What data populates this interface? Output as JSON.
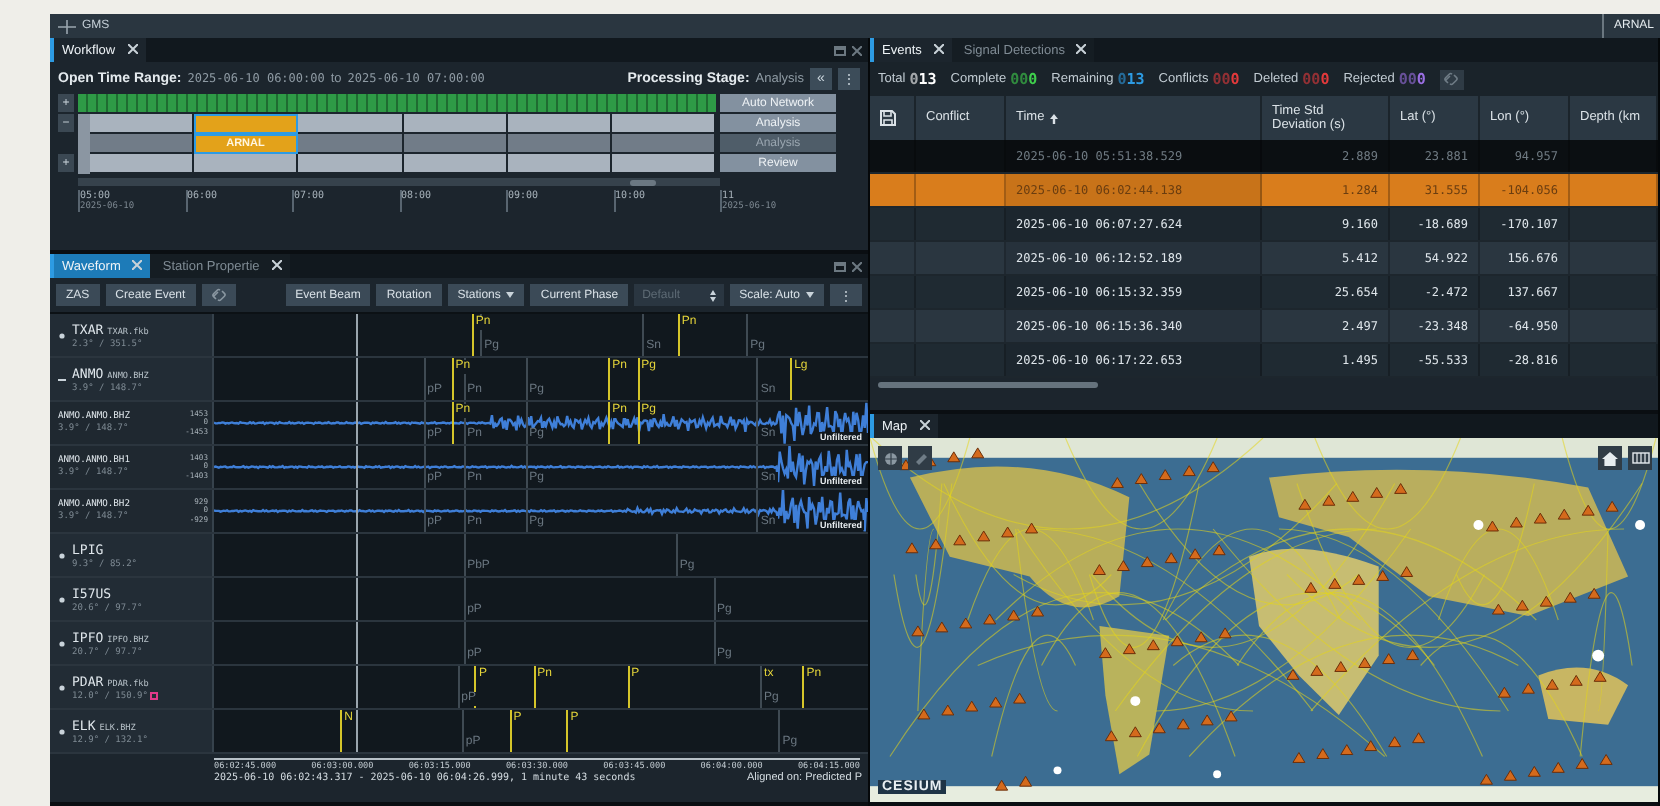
{
  "app": {
    "title": "GMS",
    "user": "ARNAL"
  },
  "workflow": {
    "tab": "Workflow",
    "range_label": "Open Time Range:",
    "range_start": "2025-06-10 06:00:00",
    "range_joiner": "to",
    "range_end": "2025-06-10 07:00:00",
    "stage_label": "Processing Stage:",
    "stage": "Analysis",
    "collapse_button": "«",
    "menu_button": "⋮",
    "rows": [
      {
        "kind": "network",
        "toggle": "+",
        "stage": "Auto Network",
        "disabled": false
      },
      {
        "kind": "interval",
        "toggle": "−",
        "stage": "Analysis",
        "disabled": false,
        "cells": [
          {
            "selected": false
          },
          {
            "selected": true
          },
          {
            "selected": false
          },
          {
            "selected": false
          },
          {
            "selected": false
          },
          {
            "selected": false
          }
        ]
      },
      {
        "kind": "interval",
        "stage": "Analysis",
        "disabled": true,
        "cells": [
          {
            "selected": false
          },
          {
            "selected": true,
            "label": "ARNAL"
          },
          {
            "selected": false
          },
          {
            "selected": false
          },
          {
            "selected": false
          },
          {
            "selected": false
          }
        ]
      },
      {
        "kind": "interval",
        "toggle": "+",
        "stage": "Review",
        "disabled": false,
        "cells": [
          {
            "selected": false
          },
          {
            "selected": false
          },
          {
            "selected": false
          },
          {
            "selected": false
          },
          {
            "selected": false
          },
          {
            "selected": false
          }
        ]
      }
    ],
    "axis": [
      {
        "time": "05:00",
        "date": "2025-06-10"
      },
      {
        "time": "06:00"
      },
      {
        "time": "07:00"
      },
      {
        "time": "08:00"
      },
      {
        "time": "09:00"
      },
      {
        "time": "10:00"
      },
      {
        "time": "11",
        "date": "2025-06-10"
      }
    ]
  },
  "waveform": {
    "tabs": [
      {
        "label": "Waveform",
        "selected": true
      },
      {
        "label": "Station Propertie",
        "selected": false
      }
    ],
    "toolbar": [
      {
        "kind": "button",
        "label": "ZAS"
      },
      {
        "kind": "button",
        "label": "Create Event"
      },
      {
        "kind": "icon"
      },
      {
        "kind": "spacer"
      },
      {
        "kind": "button",
        "label": "Event Beam"
      },
      {
        "kind": "button",
        "label": "Rotation"
      },
      {
        "kind": "menu",
        "label": "Stations"
      },
      {
        "kind": "button",
        "label": "Current Phase"
      },
      {
        "kind": "select",
        "label": "Default",
        "disabled": true
      },
      {
        "kind": "menu",
        "label": "Scale: Auto"
      },
      {
        "kind": "more",
        "label": "⋮"
      }
    ],
    "rows": [
      {
        "kind": "station",
        "name": "TXAR",
        "channel": "TXAR.fkb",
        "location": "2.3° / 351.5°",
        "expanded": false,
        "flagged": false,
        "phases": [
          {
            "label": "Pn",
            "kind": "detection"
          },
          {
            "label": "Pg",
            "kind": "predicted"
          },
          {
            "label": "Sn",
            "kind": "predicted"
          },
          {
            "label": "Pn",
            "kind": "detection"
          },
          {
            "label": "Pg",
            "kind": "predicted"
          }
        ]
      },
      {
        "kind": "station",
        "name": "ANMO",
        "channel": "ANMO.BHZ",
        "location": "3.9° / 148.7°",
        "expanded": true,
        "flagged": false,
        "phases": [
          {
            "label": "pP",
            "kind": "predicted"
          },
          {
            "label": "Pn",
            "kind": "detection"
          },
          {
            "label": "Pn",
            "kind": "predicted"
          },
          {
            "label": "Pg",
            "kind": "predicted"
          },
          {
            "label": "Pn",
            "kind": "detection"
          },
          {
            "label": "Pg",
            "kind": "detection"
          },
          {
            "label": "Sn",
            "kind": "predicted"
          },
          {
            "label": "Lg",
            "kind": "detection"
          }
        ]
      },
      {
        "kind": "channel",
        "name": "ANMO.ANMO.BHZ",
        "location": "3.9° / 148.7°",
        "scale": [
          "1453",
          "0",
          "-1453"
        ],
        "filter": "Unfiltered",
        "phases": [
          {
            "label": "pP",
            "kind": "predicted"
          },
          {
            "label": "Pn",
            "kind": "detection"
          },
          {
            "label": "Pn",
            "kind": "predicted"
          },
          {
            "label": "Pg",
            "kind": "predicted"
          },
          {
            "label": "Pn",
            "kind": "detection"
          },
          {
            "label": "Pg",
            "kind": "detection"
          },
          {
            "label": "Sn",
            "kind": "predicted"
          }
        ]
      },
      {
        "kind": "channel",
        "name": "ANMO.ANMO.BH1",
        "location": "3.9° / 148.7°",
        "scale": [
          "1403",
          "0",
          "-1403"
        ],
        "filter": "Unfiltered",
        "phases": [
          {
            "label": "pP",
            "kind": "predicted"
          },
          {
            "label": "Pn",
            "kind": "predicted"
          },
          {
            "label": "Pg",
            "kind": "predicted"
          },
          {
            "label": "Sn",
            "kind": "predicted"
          }
        ]
      },
      {
        "kind": "channel",
        "name": "ANMO.ANMO.BH2",
        "location": "3.9° / 148.7°",
        "scale": [
          "929",
          "0",
          "-929"
        ],
        "filter": "Unfiltered",
        "phases": [
          {
            "label": "pP",
            "kind": "predicted"
          },
          {
            "label": "Pn",
            "kind": "predicted"
          },
          {
            "label": "Pg",
            "kind": "predicted"
          },
          {
            "label": "Sn",
            "kind": "predicted"
          }
        ]
      },
      {
        "kind": "station",
        "name": "LPIG",
        "location": "9.3° / 85.2°",
        "expanded": false,
        "flagged": false,
        "phases": [
          {
            "label": "PbP",
            "kind": "predicted"
          },
          {
            "label": "Pg",
            "kind": "predicted"
          }
        ]
      },
      {
        "kind": "station",
        "name": "I57US",
        "location": "20.6° / 97.7°",
        "expanded": false,
        "flagged": false,
        "phases": [
          {
            "label": "pP",
            "kind": "predicted"
          },
          {
            "label": "Pg",
            "kind": "predicted"
          }
        ]
      },
      {
        "kind": "station",
        "name": "IPFO",
        "channel": "IPFO.BHZ",
        "location": "20.7° / 97.7°",
        "expanded": false,
        "flagged": false,
        "phases": [
          {
            "label": "pP",
            "kind": "predicted"
          },
          {
            "label": "Pg",
            "kind": "predicted"
          }
        ]
      },
      {
        "kind": "station",
        "name": "PDAR",
        "channel": "PDAR.fkb",
        "location": "12.0° / 150.9°",
        "expanded": false,
        "flagged": true,
        "phases": [
          {
            "label": "pP",
            "kind": "predicted"
          },
          {
            "label": "P",
            "kind": "detection"
          },
          {
            "label": "Pn",
            "kind": "detection"
          },
          {
            "label": "P",
            "kind": "detection"
          },
          {
            "label": "tx",
            "kind": "detection"
          },
          {
            "label": "Pg",
            "kind": "predicted"
          },
          {
            "label": "Pn",
            "kind": "detection"
          }
        ]
      },
      {
        "kind": "station",
        "name": "ELK",
        "channel": "ELK.BHZ",
        "location": "12.9° / 132.1°",
        "expanded": false,
        "flagged": false,
        "phases": [
          {
            "label": "N",
            "kind": "detection"
          },
          {
            "label": "pP",
            "kind": "predicted"
          },
          {
            "label": "P",
            "kind": "detection"
          },
          {
            "label": "P",
            "kind": "detection"
          },
          {
            "label": "Pg",
            "kind": "predicted"
          }
        ]
      }
    ],
    "ticks": [
      "06:02:45.000",
      "06:03:00.000",
      "06:03:15.000",
      "06:03:30.000",
      "06:03:45.000",
      "06:04:00.000",
      "06:04:15.000"
    ],
    "range": "2025-06-10 06:02:43.317 - 2025-06-10 06:04:26.999, 1 minute 43 seconds",
    "alignment": "Aligned on: Predicted P"
  },
  "events": {
    "tabs": [
      {
        "label": "Events",
        "selected": true
      },
      {
        "label": "Signal Detections",
        "selected": false
      }
    ],
    "summary": [
      {
        "label": "Total",
        "dim": "0",
        "count": "13",
        "color": "#ffffff"
      },
      {
        "label": "Complete",
        "dim": "00",
        "count": "0",
        "color": "#3fcf4c"
      },
      {
        "label": "Remaining",
        "dim": "0",
        "count": "13",
        "color": "#2d9be3"
      },
      {
        "label": "Conflicts",
        "dim": "00",
        "count": "0",
        "color": "#e3393b"
      },
      {
        "label": "Deleted",
        "dim": "00",
        "count": "0",
        "color": "#e3393b"
      },
      {
        "label": "Rejected",
        "dim": "00",
        "count": "0",
        "color": "#9b6fe3"
      }
    ],
    "columns": [
      "Conflict",
      "Time",
      "Time Std Deviation (s)",
      "Lat (°)",
      "Lon (°)",
      "Depth (km"
    ],
    "rows": [
      {
        "time": "2025-06-10 05:51:38.529",
        "std": "2.889",
        "lat": "23.881",
        "lon": "94.957",
        "selected": false,
        "dimmed": true
      },
      {
        "time": "2025-06-10 06:02:44.138",
        "std": "1.284",
        "lat": "31.555",
        "lon": "-104.056",
        "selected": true,
        "dimmed": false
      },
      {
        "time": "2025-06-10 06:07:27.624",
        "std": "9.160",
        "lat": "-18.689",
        "lon": "-170.107",
        "selected": false,
        "dimmed": false
      },
      {
        "time": "2025-06-10 06:12:52.189",
        "std": "5.412",
        "lat": "54.922",
        "lon": "156.676",
        "selected": false,
        "dimmed": false
      },
      {
        "time": "2025-06-10 06:15:32.359",
        "std": "25.654",
        "lat": "-2.472",
        "lon": "137.667",
        "selected": false,
        "dimmed": false
      },
      {
        "time": "2025-06-10 06:15:36.340",
        "std": "2.497",
        "lat": "-23.348",
        "lon": "-64.950",
        "selected": false,
        "dimmed": false
      },
      {
        "time": "2025-06-10 06:17:22.653",
        "std": "1.495",
        "lat": "-55.533",
        "lon": "-28.816",
        "selected": false,
        "dimmed": false
      }
    ]
  },
  "map": {
    "tab": "Map",
    "logo": "CESIUM"
  }
}
